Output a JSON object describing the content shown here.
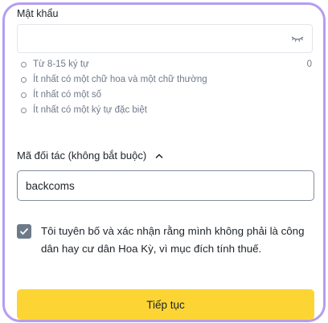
{
  "password": {
    "label": "Mật khẩu",
    "value": "",
    "toggle_icon": "eye-closed-icon",
    "char_count": "0",
    "rules": [
      "Từ 8-15 ký tự",
      "Ít nhất có một chữ hoa và một chữ thường",
      "Ít nhất có một số",
      "Ít nhất có một ký tự đặc biệt"
    ]
  },
  "referral": {
    "toggle_label": "Mã đối tác (không bắt buộc)",
    "toggle_icon": "chevron-up-icon",
    "value": "backcoms"
  },
  "declaration": {
    "checked": true,
    "text": "Tôi tuyên bố và xác nhận rằng mình không phải là công dân hay cư dân Hoa Kỳ, vì mục đích tính thuế."
  },
  "submit_label": "Tiếp tục",
  "colors": {
    "primary": "#FCD535",
    "frame_border": "#B69CF0",
    "checkbox": "#6C7A89",
    "muted_text": "#707A8A"
  }
}
